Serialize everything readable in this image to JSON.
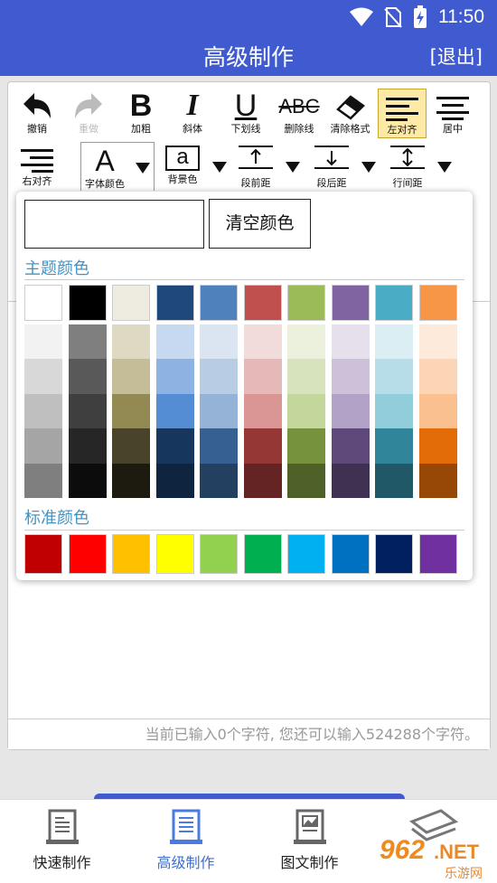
{
  "status": {
    "time": "11:50"
  },
  "header": {
    "title": "高级制作",
    "exit_label": "[退出]"
  },
  "toolbar": {
    "undo": "撤销",
    "redo": "重做",
    "bold": "加粗",
    "italic": "斜体",
    "underline": "下划线",
    "strikethrough": "删除线",
    "strike_glyph": "ABC",
    "clear_format": "清除格式",
    "align_left": "左对齐",
    "center": "居中",
    "align_right": "右对齐",
    "font_color": "字体颜色",
    "font_color_glyph": "A",
    "bg_color": "背景色",
    "bg_color_glyph": "a",
    "para_before": "段前距",
    "para_after": "段后距",
    "line_spacing": "行间距"
  },
  "color_picker": {
    "clear_label": "清空颜色",
    "theme_title": "主题颜色",
    "standard_title": "标准颜色",
    "theme_columns": [
      [
        "#ffffff",
        "#f2f2f2",
        "#d8d8d8",
        "#bfbfbf",
        "#a5a5a5",
        "#7f7f7f"
      ],
      [
        "#000000",
        "#7f7f7f",
        "#595959",
        "#3f3f3f",
        "#262626",
        "#0c0c0c"
      ],
      [
        "#eeece1",
        "#ddd9c3",
        "#c4bd97",
        "#938953",
        "#494429",
        "#1d1b10"
      ],
      [
        "#1f497d",
        "#c6d9f0",
        "#8db3e2",
        "#548dd4",
        "#17365d",
        "#0f243e"
      ],
      [
        "#4f81bd",
        "#dbe5f1",
        "#b8cce4",
        "#95b3d7",
        "#366092",
        "#244061"
      ],
      [
        "#c0504d",
        "#f2dcdb",
        "#e5b9b7",
        "#d99694",
        "#953734",
        "#632423"
      ],
      [
        "#9bbb59",
        "#ebf1dd",
        "#d7e3bc",
        "#c3d69b",
        "#76923c",
        "#4f6128"
      ],
      [
        "#8064a2",
        "#e5e0ec",
        "#ccc1d9",
        "#b2a2c7",
        "#5f497a",
        "#3f3151"
      ],
      [
        "#4bacc6",
        "#dbeef3",
        "#b7dde8",
        "#92cddc",
        "#31859b",
        "#205867"
      ],
      [
        "#f79646",
        "#fdeada",
        "#fbd5b5",
        "#fac08f",
        "#e36c09",
        "#974806"
      ]
    ],
    "standard_colors": [
      "#c00000",
      "#ff0000",
      "#ffc000",
      "#ffff00",
      "#92d050",
      "#00b050",
      "#00b0f0",
      "#0070c0",
      "#002060",
      "#7030a0"
    ]
  },
  "editor": {
    "counter_text": "当前已输入0个字符, 您还可以输入524288个字符。"
  },
  "bottom_nav": {
    "items": [
      "快速制作",
      "高级制作",
      "图文制作",
      ""
    ],
    "active_index": 1
  },
  "watermark": {
    "brand": "962",
    "net": ".NET",
    "sub": "乐游网"
  },
  "colors": {
    "accent": "#3f5bcf",
    "section_title": "#3e95c9",
    "active_tool_bg": "#ffe9a6"
  },
  "icons": [
    "wifi-icon",
    "no-sim-icon",
    "battery-charging-icon",
    "undo-icon",
    "redo-icon",
    "eraser-icon",
    "align-left-icon",
    "align-center-icon",
    "align-right-icon",
    "dropdown-arrow-icon",
    "line-spacing-icon",
    "document-icon"
  ]
}
